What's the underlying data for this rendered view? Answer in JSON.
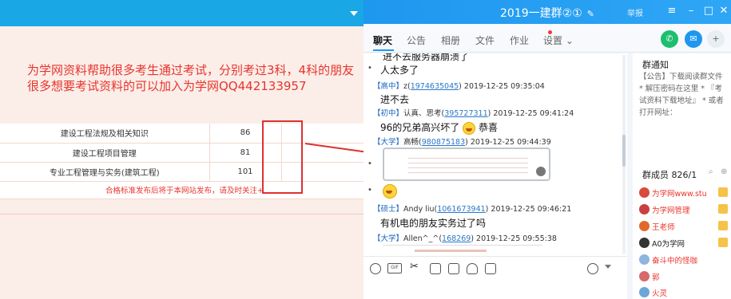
{
  "left_page": {
    "ad_text": "为学网资料帮助很多考生通过考试，分别考过3科，4科的朋友很多想要考试资料的可以加入为学网QQ442133957",
    "rows": [
      {
        "subject": "建设工程法规及相关知识",
        "count": "86"
      },
      {
        "subject": "建设工程项目管理",
        "count": "81"
      },
      {
        "subject": "专业工程管理与实务(建筑工程)",
        "count": "101"
      }
    ],
    "notice": "合格标准发布后将于本网站发布，请及时关注+"
  },
  "qq": {
    "title": "2019一建群②①",
    "report_label": "举报",
    "tabs": [
      {
        "label": "聊天"
      },
      {
        "label": "公告"
      },
      {
        "label": "相册"
      },
      {
        "label": "文件"
      },
      {
        "label": "作业"
      },
      {
        "label": "设置 ⌄"
      }
    ],
    "messages": {
      "cut_top": "进不去服务器崩溃了",
      "m1_text": "人太多了",
      "m2_level": "【高中】",
      "m2_name": "z(",
      "m2_qq": "1974635045",
      "m2_time": ") 2019-12-25 09:35:04",
      "m2_text": "进不去",
      "m3_level": "【初中】",
      "m3_name": "认真、思考(",
      "m3_qq": "395727311",
      "m3_time": ") 2019-12-25 09:41:24",
      "m3_text": "96的兄弟高兴坏了",
      "m3_text2": "恭喜",
      "m4_level": "【大学】",
      "m4_name": "高畅(",
      "m4_qq": "980875183",
      "m4_time": ") 2019-12-25 09:44:39",
      "m5_level": "【硕士】",
      "m5_name": "Andy liu(",
      "m5_qq": "1061673941",
      "m5_time": ") 2019-12-25 09:46:21",
      "m5_text": "有机电的朋友实务过了吗",
      "m6_level": "【大学】",
      "m6_name": "Allen^_^(",
      "m6_qq": "168269",
      "m6_time": ") 2019-12-25 09:55:38"
    },
    "side": {
      "notice_heading": "群通知",
      "notice_text": "【公告】下载阅读群文件 * 解压密码在这里 * 『考试资料下载地址』 * 或者打开网址：",
      "members_heading": "群成员 826/1",
      "members": [
        {
          "name": "为学网www.stu",
          "color": "#e8342c"
        },
        {
          "name": "为学网管理",
          "color": "#e8342c"
        },
        {
          "name": "王老师",
          "color": "#e8342c"
        },
        {
          "name": "A0为学网",
          "color": "#222222"
        },
        {
          "name": "奋斗中的怪咖",
          "color": "#e8342c"
        },
        {
          "name": "郭",
          "color": "#e8342c"
        },
        {
          "name": "火灵",
          "color": "#e8342c"
        }
      ]
    }
  }
}
